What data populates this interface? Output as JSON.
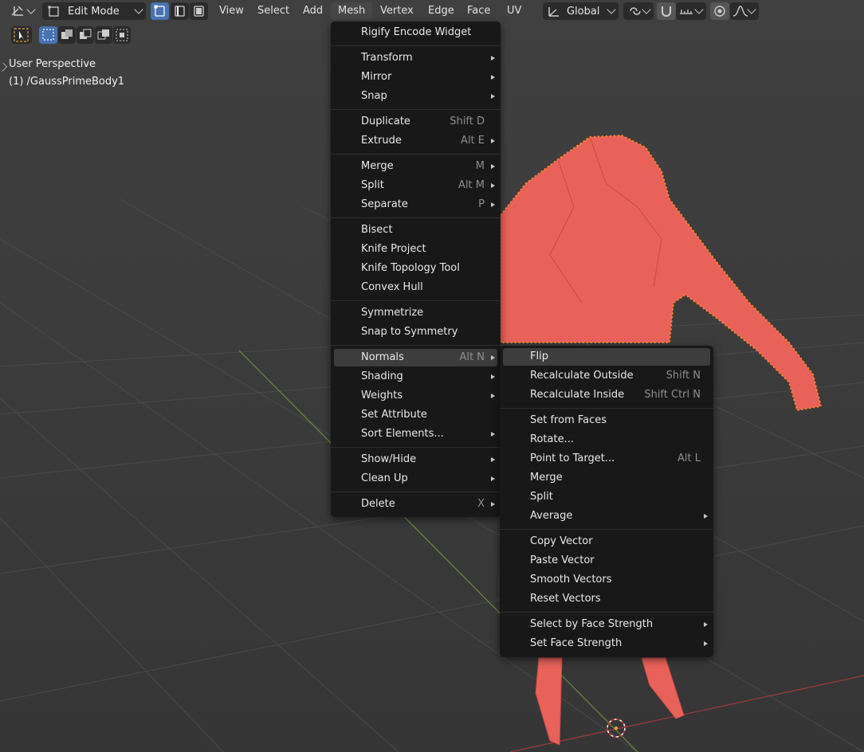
{
  "header": {
    "mode_label": "Edit Mode",
    "menus": [
      "View",
      "Select",
      "Add",
      "Mesh",
      "Vertex",
      "Edge",
      "Face",
      "UV"
    ],
    "open_menu": "Mesh",
    "orientation_label": "Global"
  },
  "overlay": {
    "perspective": "User Perspective",
    "object": "(1) /GaussPrimeBody1"
  },
  "mesh_menu": {
    "items": [
      {
        "label": "Rigify Encode Widget",
        "shortcut": "",
        "submenu": false
      },
      {
        "label": "Transform",
        "shortcut": "",
        "submenu": true
      },
      {
        "label": "Mirror",
        "shortcut": "",
        "submenu": true
      },
      {
        "label": "Snap",
        "shortcut": "",
        "submenu": true
      },
      {
        "label": "Duplicate",
        "shortcut": "Shift D",
        "submenu": false
      },
      {
        "label": "Extrude",
        "shortcut": "Alt E",
        "submenu": true
      },
      {
        "label": "Merge",
        "shortcut": "M",
        "submenu": true
      },
      {
        "label": "Split",
        "shortcut": "Alt M",
        "submenu": true
      },
      {
        "label": "Separate",
        "shortcut": "P",
        "submenu": true
      },
      {
        "label": "Bisect",
        "shortcut": "",
        "submenu": false
      },
      {
        "label": "Knife Project",
        "shortcut": "",
        "submenu": false
      },
      {
        "label": "Knife Topology Tool",
        "shortcut": "",
        "submenu": false
      },
      {
        "label": "Convex Hull",
        "shortcut": "",
        "submenu": false
      },
      {
        "label": "Symmetrize",
        "shortcut": "",
        "submenu": false
      },
      {
        "label": "Snap to Symmetry",
        "shortcut": "",
        "submenu": false
      },
      {
        "label": "Normals",
        "shortcut": "Alt N",
        "submenu": true,
        "highlighted": true
      },
      {
        "label": "Shading",
        "shortcut": "",
        "submenu": true
      },
      {
        "label": "Weights",
        "shortcut": "",
        "submenu": true
      },
      {
        "label": "Set Attribute",
        "shortcut": "",
        "submenu": false
      },
      {
        "label": "Sort Elements...",
        "shortcut": "",
        "submenu": true
      },
      {
        "label": "Show/Hide",
        "shortcut": "",
        "submenu": true
      },
      {
        "label": "Clean Up",
        "shortcut": "",
        "submenu": true
      },
      {
        "label": "Delete",
        "shortcut": "X",
        "submenu": true
      }
    ]
  },
  "normals_menu": {
    "items": [
      {
        "label": "Flip",
        "shortcut": "",
        "submenu": false,
        "highlighted": true
      },
      {
        "label": "Recalculate Outside",
        "shortcut": "Shift N",
        "submenu": false
      },
      {
        "label": "Recalculate Inside",
        "shortcut": "Shift Ctrl N",
        "submenu": false
      },
      {
        "label": "Set from Faces",
        "shortcut": "",
        "submenu": false
      },
      {
        "label": "Rotate...",
        "shortcut": "",
        "submenu": false
      },
      {
        "label": "Point to Target...",
        "shortcut": "Alt L",
        "submenu": false
      },
      {
        "label": "Merge",
        "shortcut": "",
        "submenu": false
      },
      {
        "label": "Split",
        "shortcut": "",
        "submenu": false
      },
      {
        "label": "Average",
        "shortcut": "",
        "submenu": true
      },
      {
        "label": "Copy Vector",
        "shortcut": "",
        "submenu": false
      },
      {
        "label": "Paste Vector",
        "shortcut": "",
        "submenu": false
      },
      {
        "label": "Smooth Vectors",
        "shortcut": "",
        "submenu": false
      },
      {
        "label": "Reset Vectors",
        "shortcut": "",
        "submenu": false
      },
      {
        "label": "Select by Face Strength",
        "shortcut": "",
        "submenu": true
      },
      {
        "label": "Set Face Strength",
        "shortcut": "",
        "submenu": true
      }
    ]
  },
  "colors": {
    "accent": "#4772b3",
    "mesh": "#e8625a",
    "vertex": "#ff8a1f",
    "menu_bg": "#181818"
  }
}
